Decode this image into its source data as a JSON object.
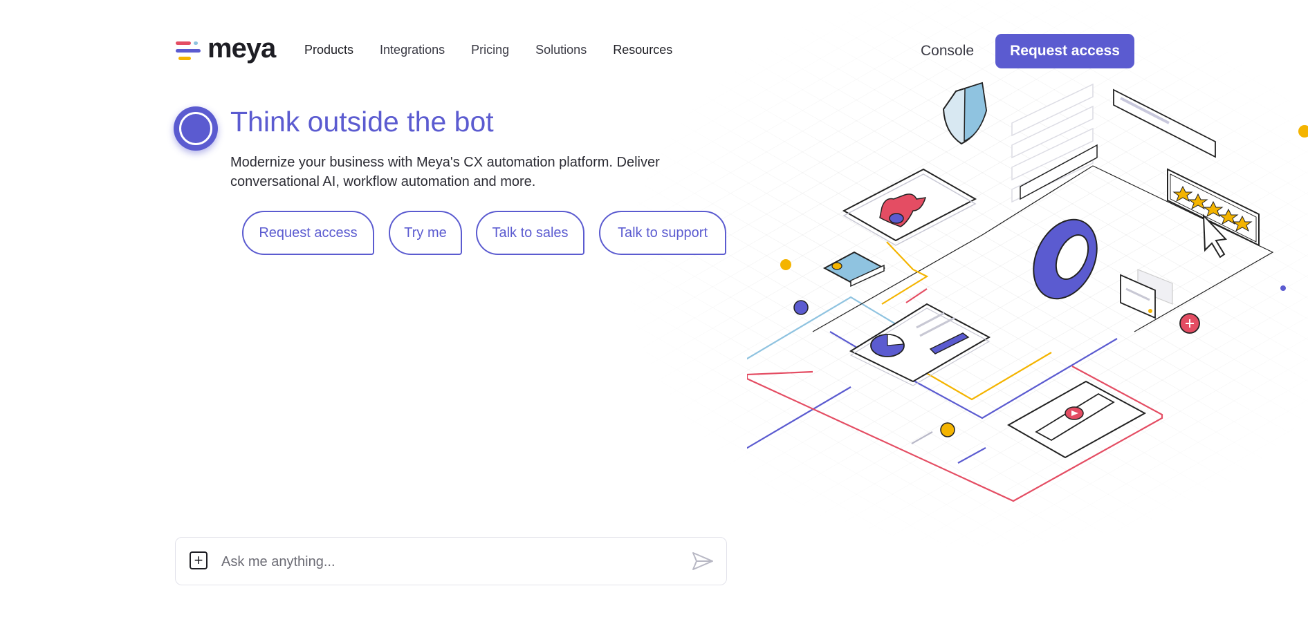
{
  "brand": {
    "name": "meya",
    "colors": {
      "accent": "#5b5bd0",
      "red": "#e44d63",
      "yellow": "#f4b400",
      "light_blue": "#8fc3e0"
    }
  },
  "nav": {
    "items": [
      {
        "label": "Products"
      },
      {
        "label": "Integrations"
      },
      {
        "label": "Pricing"
      },
      {
        "label": "Solutions"
      },
      {
        "label": "Resources"
      }
    ],
    "console_label": "Console",
    "request_label": "Request access"
  },
  "hero": {
    "title": "Think outside the bot",
    "subtitle": "Modernize your business with Meya's CX automation platform. Deliver conversational AI, workflow automation and more."
  },
  "quick_replies": [
    {
      "label": "Request access"
    },
    {
      "label": "Try me"
    },
    {
      "label": "Talk to sales"
    },
    {
      "label": "Talk to support"
    }
  ],
  "chat": {
    "placeholder": "Ask me anything...",
    "value": ""
  }
}
